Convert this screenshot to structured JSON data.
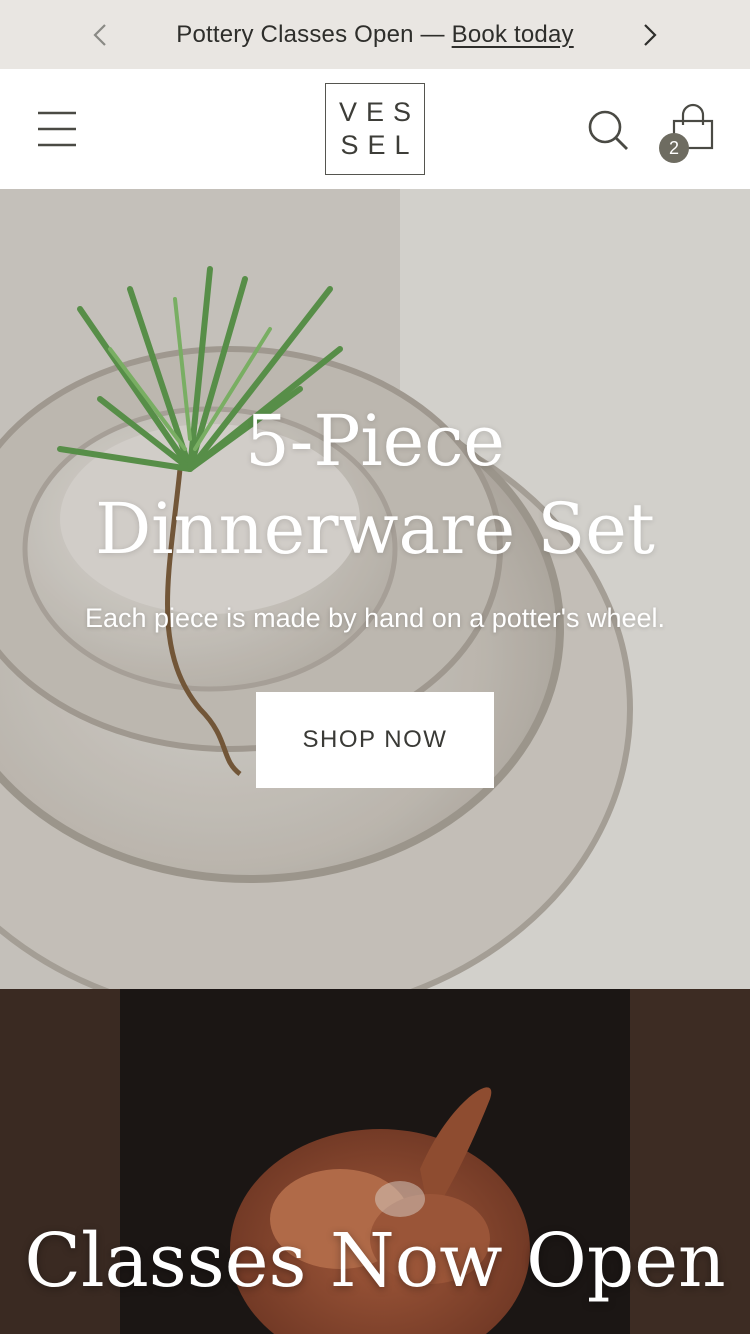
{
  "announcement": {
    "prev_icon": "chevron-left-icon",
    "text": "Pottery Classes Open —",
    "link_text": "Book today",
    "next_icon": "chevron-right-icon"
  },
  "header": {
    "menu_icon": "hamburger-menu-icon",
    "logo_line1": "VES",
    "logo_line2": "SEL",
    "search_icon": "search-icon",
    "cart_icon": "shopping-bag-icon",
    "cart_count": "2"
  },
  "hero": {
    "title_line1": "5-Piece",
    "title_line2": "Dinnerware Set",
    "subtitle": "Each piece is made by hand on a potter's wheel.",
    "cta_label": "SHOP NOW"
  },
  "classes": {
    "title": "Classes Now Open"
  },
  "colors": {
    "announcement_bg": "#e9e6e2",
    "cart_badge": "#6e6c61",
    "text": "#3a3a36"
  }
}
